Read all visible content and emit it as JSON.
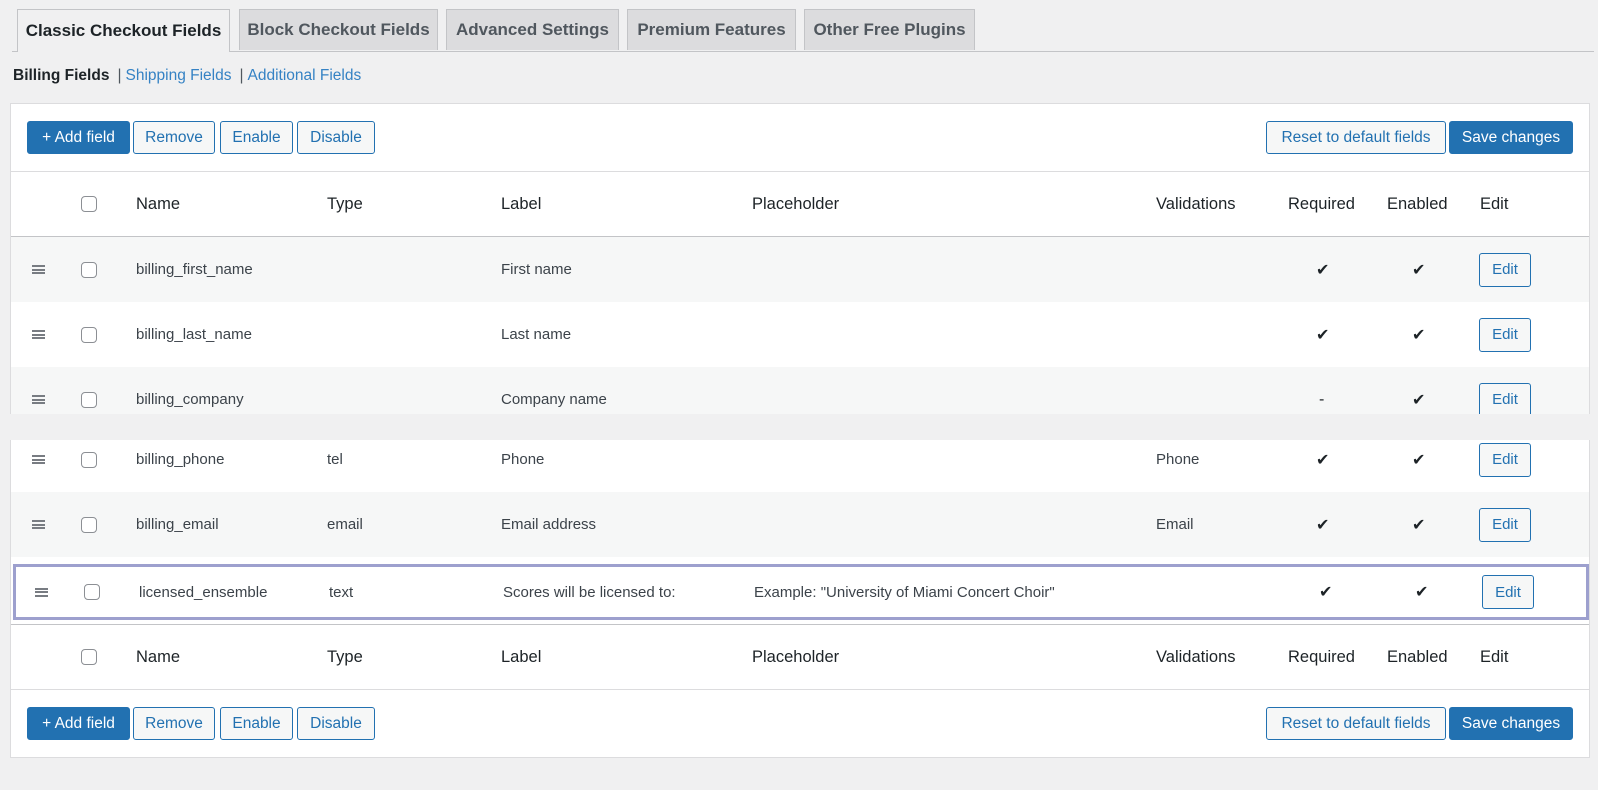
{
  "tabs": [
    {
      "label": "Classic Checkout Fields"
    },
    {
      "label": "Block Checkout Fields"
    },
    {
      "label": "Advanced Settings"
    },
    {
      "label": "Premium Features"
    },
    {
      "label": "Other Free Plugins"
    }
  ],
  "subnav": {
    "billing": "Billing Fields",
    "sep": "|",
    "shipping": "Shipping Fields",
    "additional": "Additional Fields"
  },
  "toolbar": {
    "add": "+ Add field",
    "remove": "Remove",
    "enable": "Enable",
    "disable": "Disable",
    "reset": "Reset to default fields",
    "save": "Save changes"
  },
  "columns": {
    "name": "Name",
    "type": "Type",
    "label": "Label",
    "placeholder": "Placeholder",
    "validations": "Validations",
    "required": "Required",
    "enabled": "Enabled",
    "edit": "Edit"
  },
  "rows": [
    {
      "name": "billing_first_name",
      "type": "",
      "label": "First name",
      "placeholder": "",
      "validations": "",
      "required": "✔",
      "enabled": "✔",
      "edit": "Edit"
    },
    {
      "name": "billing_last_name",
      "type": "",
      "label": "Last name",
      "placeholder": "",
      "validations": "",
      "required": "✔",
      "enabled": "✔",
      "edit": "Edit"
    },
    {
      "name": "billing_company",
      "type": "",
      "label": "Company name",
      "placeholder": "",
      "validations": "",
      "required": "-",
      "enabled": "✔",
      "edit": "Edit"
    },
    {
      "name": "billing_phone",
      "type": "tel",
      "label": "Phone",
      "placeholder": "",
      "validations": "Phone",
      "required": "✔",
      "enabled": "✔",
      "edit": "Edit"
    },
    {
      "name": "billing_email",
      "type": "email",
      "label": "Email address",
      "placeholder": "",
      "validations": "Email",
      "required": "✔",
      "enabled": "✔",
      "edit": "Edit"
    },
    {
      "name": "licensed_ensemble",
      "type": "text",
      "label": "Scores will be licensed to:",
      "placeholder": "Example: \"University of Miami Concert Choir\"",
      "validations": "",
      "required": "✔",
      "enabled": "✔",
      "edit": "Edit"
    }
  ],
  "colors": {
    "accent": "#2271b1",
    "link": "#3582c4",
    "highlight_border": "#9da0ce"
  },
  "icons": {
    "drag": "drag-handle-icon",
    "check": "checkmark-icon"
  }
}
